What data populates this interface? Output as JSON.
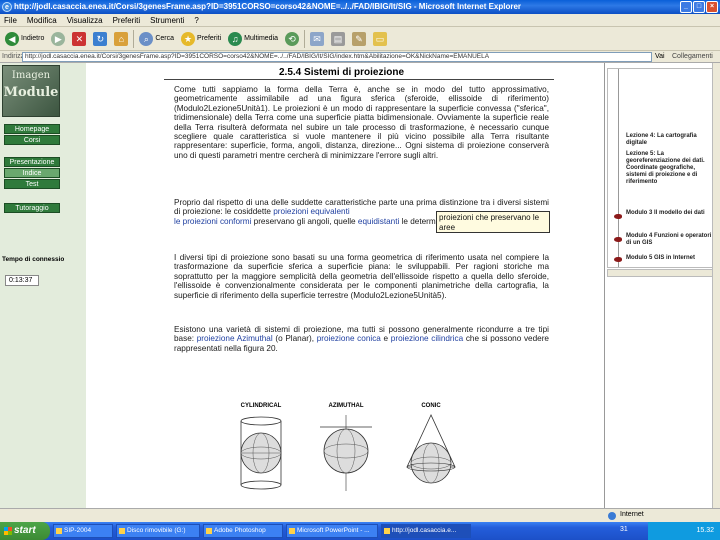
{
  "window": {
    "title": "http://jodl.casaccia.enea.it/Corsi/3genesFrame.asp?ID=3951CORSO=corso42&NOME=../../FAD/IBIG/It/SIG - Microsoft Internet Explorer"
  },
  "menu": [
    "File",
    "Modifica",
    "Visualizza",
    "Preferiti",
    "Strumenti",
    "?"
  ],
  "toolbar": {
    "back_label": "Indietro",
    "search_label": "Cerca",
    "favorites_label": "Preferiti",
    "media_label": "Multimedia"
  },
  "address": {
    "label": "Indirizzo",
    "value": "http://jodl.casaccia.enea.it/Corsi/3genesFrame.asp?ID=3951CORSO=corso42&NOME=../../FAD/IBIG/It/SIG/index.htm&Abilitazione=OK&NickName=EMANUELA",
    "go_label": "Vai",
    "links_label": "Collegamenti"
  },
  "sidebar": {
    "logo_top": "Imagen",
    "logo_main": "Module",
    "buttons": [
      "Homepage",
      "Corsi",
      "Presentazione",
      "Indice",
      "Test",
      "Tutoraggio"
    ],
    "tempo_label": "Tempo di connessione:",
    "timer": "0:13:37"
  },
  "content": {
    "title": "2.5.4 Sistemi di proiezione",
    "p1": "Come tutti sappiamo la forma della Terra è, anche se in modo del tutto approssimativo, geometricamente assimilabile ad una figura sferica (sferoide, ellissoide di riferimento) (Modulo2Lezione5Unità1). Le proiezioni è un modo di rappresentare la superficie convessa (\"sferica\", tridimensionale) della Terra come una superficie piatta bidimensionale. Ovviamente la superficie reale della Terra risulterà deformata nel subire un tale processo di trasformazione, è necessario cunque scegliere quale caratteristica si vuole mantenere il più vicino possibile alla Terra risultante rappresentare: superficie, forma, angoli, distanza, direzione... Ogni sistema di proiezione conserverà uno di questi parametri mentre cercherà di minimizzare l'errore sugli altri.",
    "p2a": "Proprio dal rispetto di una delle suddette caratteristiche parte una prima distinzione tra i diversi sistemi di proiezione: le cosiddette ",
    "p2_link1": "proiezioni equivalenti",
    "p2b": " ",
    "p2_link2": "le proiezioni conformi",
    "p2c": " preservano gli angoli, quelle ",
    "p2_link3": "equidistanti",
    "p2d": " le determinati.",
    "tooltip": "proiezioni che preservano le aree",
    "p3": "I diversi tipi di proiezione sono basati su una forma geometrica di riferimento usata nel compiere la trasformazione da superficie sferica a superficie piana: le sviluppabili. Per ragioni storiche ma soprattutto per la maggiore semplicità della geometria dell'ellissoide rispetto a quella dello sferoide, l'ellissoide è convenzionalmente considerata per le componenti planimetriche della cartografia, la superficie di riferimento della superficie terrestre (Modulo2Lezione5Unità5).",
    "p4a": "Esistono una varietà di sistemi di proiezione, ma tutti si possono generalmente ricondurre a tre tipi base: ",
    "p4_link1": "proiezione Azimuthal",
    "p4b": " (o Planar), ",
    "p4_link2": "proiezione conica",
    "p4c": " e ",
    "p4_link3": "proiezione cilindrica",
    "p4d": " che si possono vedere rappresentati nella figura 20.",
    "figures": [
      "CYLINDRICAL",
      "AZIMUTHAL",
      "CONIC"
    ]
  },
  "rightpane": {
    "items": [
      "Lezione 4: La cartografia digitale",
      "Lezione 5: La georeferenziazione dei dati. Coordinate geografiche, sistemi di proiezione e di riferimento",
      "Modulo 3 Il modello dei dati",
      "Modulo 4 Funzioni e operatori di un GIS",
      "Modulo 5 GIS in Internet"
    ]
  },
  "status": {
    "zone": "Internet"
  },
  "taskbar": {
    "start": "start",
    "tasks": [
      "SIP-2004",
      "Disco rimovibile (G:)",
      "Adobe Photoshop",
      "Microsoft PowerPoint - ...",
      "http://jodl.casaccia.e..."
    ],
    "page": "31",
    "clock": "15.32"
  },
  "colors": {
    "nav_green": "#2f7a3b",
    "link_blue": "#1f3fa0",
    "titlebar_blue": "#0a5fd8"
  }
}
